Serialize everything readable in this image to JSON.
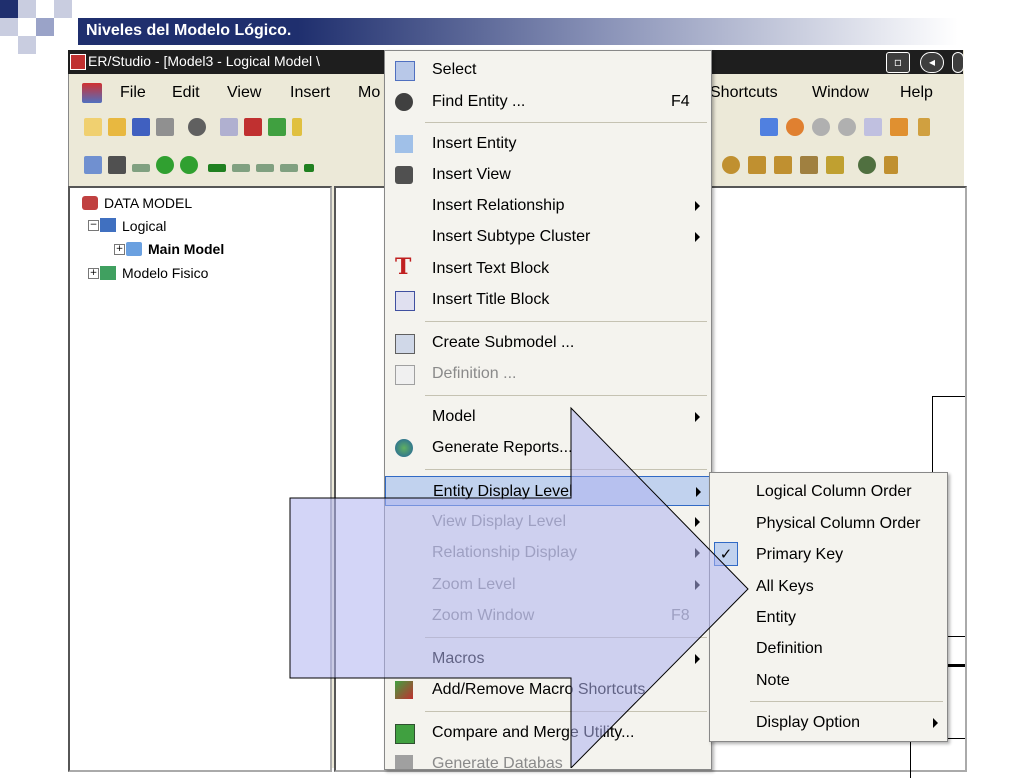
{
  "slide": {
    "title": "Niveles del Modelo Lógico."
  },
  "app": {
    "window_title": "ER/Studio - [Model3 - Logical Model \\",
    "menu": [
      "File",
      "Edit",
      "View",
      "Insert",
      "Mo",
      "Shortcuts",
      "Window",
      "Help"
    ]
  },
  "tree": {
    "root": "DATA MODEL",
    "logical": "Logical",
    "main_model": "Main Model",
    "physical": "Modelo Fisico"
  },
  "context_menu": {
    "items": [
      {
        "label": "Select",
        "shortcut": "",
        "icon": "select-arrow-icon"
      },
      {
        "label": "Find Entity ...",
        "shortcut": "F4",
        "icon": "binoculars-icon"
      },
      {
        "label": "Insert Entity",
        "shortcut": "",
        "icon": "entity-icon"
      },
      {
        "label": "Insert View",
        "shortcut": "",
        "icon": "view-icon"
      },
      {
        "label": "Insert Relationship",
        "shortcut": "",
        "icon": ""
      },
      {
        "label": "Insert Subtype Cluster",
        "shortcut": "",
        "icon": ""
      },
      {
        "label": "Insert Text Block",
        "shortcut": "",
        "icon": "text-t-icon"
      },
      {
        "label": "Insert Title Block",
        "shortcut": "",
        "icon": "title-block-icon"
      },
      {
        "label": "Create Submodel ...",
        "shortcut": "",
        "icon": "submodel-icon"
      },
      {
        "label": "Definition ...",
        "shortcut": "",
        "icon": "definition-icon"
      },
      {
        "label": "Model",
        "shortcut": "",
        "icon": ""
      },
      {
        "label": "Generate Reports...",
        "shortcut": "",
        "icon": "globe-icon"
      },
      {
        "label": "Entity Display Level",
        "shortcut": "",
        "icon": ""
      },
      {
        "label": "View Display Level",
        "shortcut": "",
        "icon": ""
      },
      {
        "label": "Relationship Display",
        "shortcut": "",
        "icon": ""
      },
      {
        "label": "Zoom Level",
        "shortcut": "",
        "icon": ""
      },
      {
        "label": "Zoom Window",
        "shortcut": "F8",
        "icon": ""
      },
      {
        "label": "Macros",
        "shortcut": "",
        "icon": ""
      },
      {
        "label": "Add/Remove Macro Shortcuts",
        "shortcut": "",
        "icon": "macro-icon"
      },
      {
        "label": "Compare and Merge Utility...",
        "shortcut": "",
        "icon": "compare-icon"
      },
      {
        "label": "Generate Databas",
        "shortcut": "",
        "icon": ""
      }
    ]
  },
  "submenu": {
    "items": [
      {
        "label": "Logical Column Order",
        "checked": false
      },
      {
        "label": "Physical Column Order",
        "checked": false
      },
      {
        "label": "Primary Key",
        "checked": true,
        "check_mark": "✓"
      },
      {
        "label": "All Keys",
        "checked": false
      },
      {
        "label": "Entity",
        "checked": false
      },
      {
        "label": "Definition",
        "checked": false
      },
      {
        "label": "Note",
        "checked": false
      },
      {
        "label": "Display Option",
        "checked": false
      }
    ]
  },
  "colors": {
    "header_blue": "#1f2f6e",
    "highlight": "#c1d2ee",
    "arrow_fill": "#b4b8f0"
  }
}
